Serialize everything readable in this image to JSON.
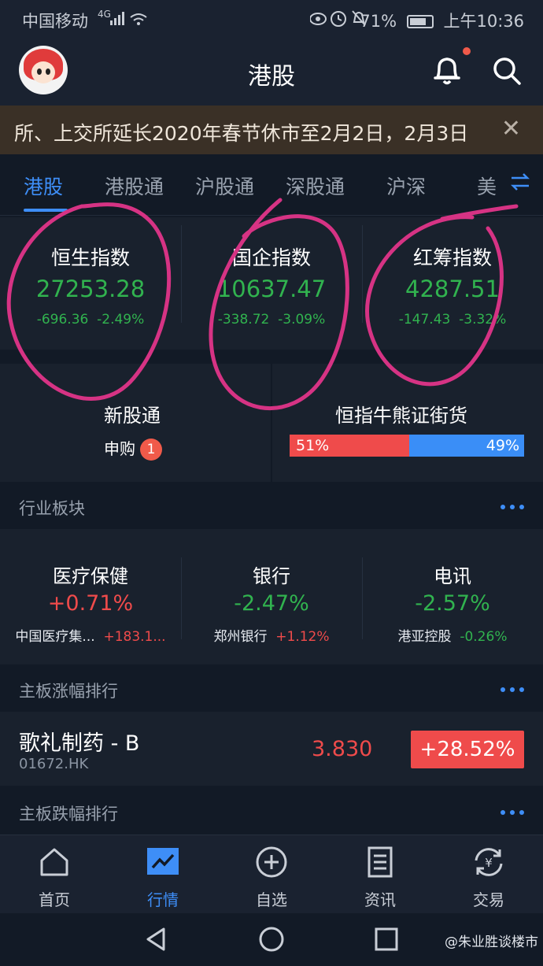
{
  "status_bar": {
    "carrier": "中国移动",
    "signal_label": "4G",
    "battery": "71%",
    "time": "上午10:36"
  },
  "header": {
    "title": "港股"
  },
  "notice": {
    "text": "所、上交所延长2020年春节休市至2月2日，2月3日",
    "close": "✕"
  },
  "tabs": [
    {
      "label": "港股",
      "active": true
    },
    {
      "label": "港股通"
    },
    {
      "label": "沪股通"
    },
    {
      "label": "深股通"
    },
    {
      "label": "沪深"
    },
    {
      "label": "美"
    }
  ],
  "indices": [
    {
      "name": "恒生指数",
      "value": "27253.28",
      "change": "-696.36",
      "pct": "-2.49%"
    },
    {
      "name": "国企指数",
      "value": "10637.47",
      "change": "-338.72",
      "pct": "-3.09%"
    },
    {
      "name": "红筹指数",
      "value": "4287.51",
      "change": "-147.43",
      "pct": "-3.32%"
    }
  ],
  "ipo": {
    "title": "新股通",
    "subscribe_label": "申购",
    "subscribe_count": "1"
  },
  "bull_bear": {
    "title": "恒指牛熊证街货",
    "bull_pct_label": "51%",
    "bear_pct_label": "49%",
    "bull_fraction": 0.51,
    "bull_color": "#ef4b4b",
    "bear_color": "#3a8ef7"
  },
  "sectors_section": {
    "label": "行业板块"
  },
  "sectors": [
    {
      "name": "医疗保健",
      "pct": "+0.71%",
      "lead_stock": "中国医疗集...",
      "lead_pct": "+183.1...",
      "trend": "up",
      "lead_trend": "up"
    },
    {
      "name": "银行",
      "pct": "-2.47%",
      "lead_stock": "郑州银行",
      "lead_pct": "+1.12%",
      "trend": "down",
      "lead_trend": "up"
    },
    {
      "name": "电讯",
      "pct": "-2.57%",
      "lead_stock": "港亚控股",
      "lead_pct": "-0.26%",
      "trend": "down",
      "lead_trend": "down"
    }
  ],
  "gainers_section": {
    "label": "主板涨幅排行"
  },
  "gainers": [
    {
      "name": "歌礼制药 - B",
      "code": "01672.HK",
      "price": "3.830",
      "pct": "+28.52%"
    }
  ],
  "losers_section": {
    "label": "主板跌幅排行"
  },
  "bottom_tabs": [
    {
      "label": "首页",
      "icon": "home-icon"
    },
    {
      "label": "行情",
      "icon": "market-chart-icon",
      "active": true
    },
    {
      "label": "自选",
      "icon": "plus-circle-icon"
    },
    {
      "label": "资讯",
      "icon": "news-icon"
    },
    {
      "label": "交易",
      "icon": "trade-yen-icon"
    }
  ],
  "watermark": "@朱业胜谈楼市",
  "colors": {
    "up": "#ef4b4b",
    "down": "#31b34f",
    "accent": "#3e8ef7",
    "annotation": "#d63384"
  }
}
